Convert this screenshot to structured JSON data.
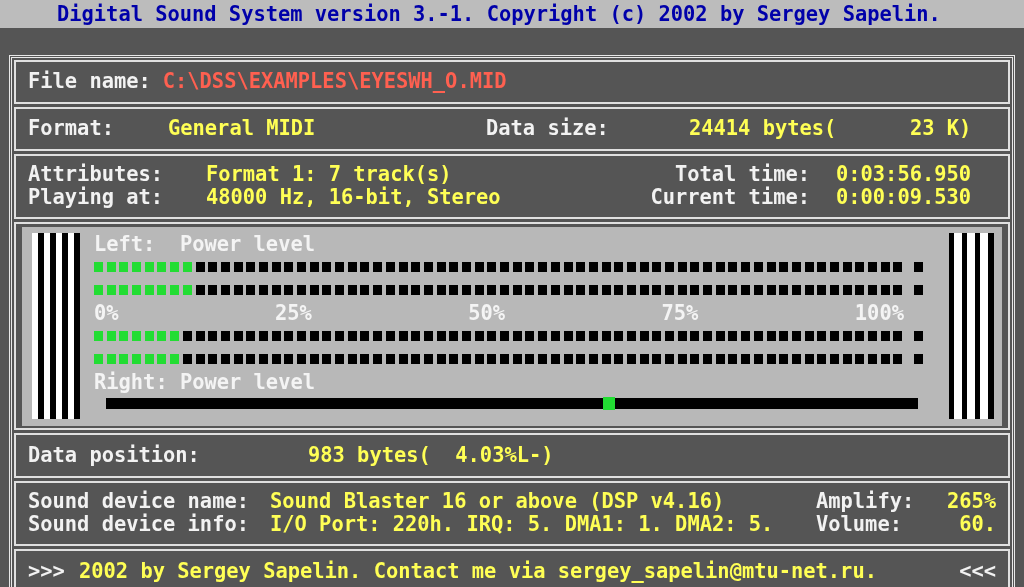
{
  "window": {
    "title": "Digital Sound System version 3.-1. Copyright (c) 2002 by Sergey Sapelin."
  },
  "file": {
    "label": "File name:",
    "value": "C:\\DSS\\EXAMPLES\\EYESWH_O.MID"
  },
  "format": {
    "label": "Format:",
    "value": "General MIDI"
  },
  "data_size": {
    "label": "Data size:",
    "value": "24414 bytes(      23 K)"
  },
  "attributes": {
    "label": "Attributes:",
    "value": "Format 1: 7 track(s)"
  },
  "total_time": {
    "label": "Total time:",
    "value": "0:03:56.950"
  },
  "playing_at": {
    "label": "Playing at:",
    "value": "48000 Hz, 16-bit, Stereo"
  },
  "current_time": {
    "label": "Current time:",
    "value": "0:00:09.530"
  },
  "meter": {
    "left_label": "Left:  Power level",
    "right_label": "Right: Power level",
    "left_channels": [
      {
        "level": 0.125
      },
      {
        "level": 0.125
      }
    ],
    "scale": [
      "0%",
      "25%",
      "50%",
      "75%",
      "100%"
    ],
    "right_channels": [
      {
        "level": 0.109
      },
      {
        "level": 0.109
      }
    ],
    "position": {
      "level": 0.62
    }
  },
  "data_position": {
    "label": "Data position:",
    "value": "983 bytes(  4.03%L-)"
  },
  "device_name": {
    "label": "Sound device name:",
    "value": "Sound Blaster 16 or above (DSP v4.16)"
  },
  "amplify": {
    "label": "Amplify:",
    "value": "265%"
  },
  "device_info": {
    "label": "Sound device info:",
    "value": "I/O Port: 220h. IRQ: 5. DMA1: 1. DMA2: 5."
  },
  "volume": {
    "label": "Volume:",
    "value": "60."
  },
  "footer": {
    "left": ">>>",
    "text": "2002 by Sergey Sapelin. Contact me via sergey_sapelin@mtu-net.ru.",
    "right": "<<<"
  }
}
